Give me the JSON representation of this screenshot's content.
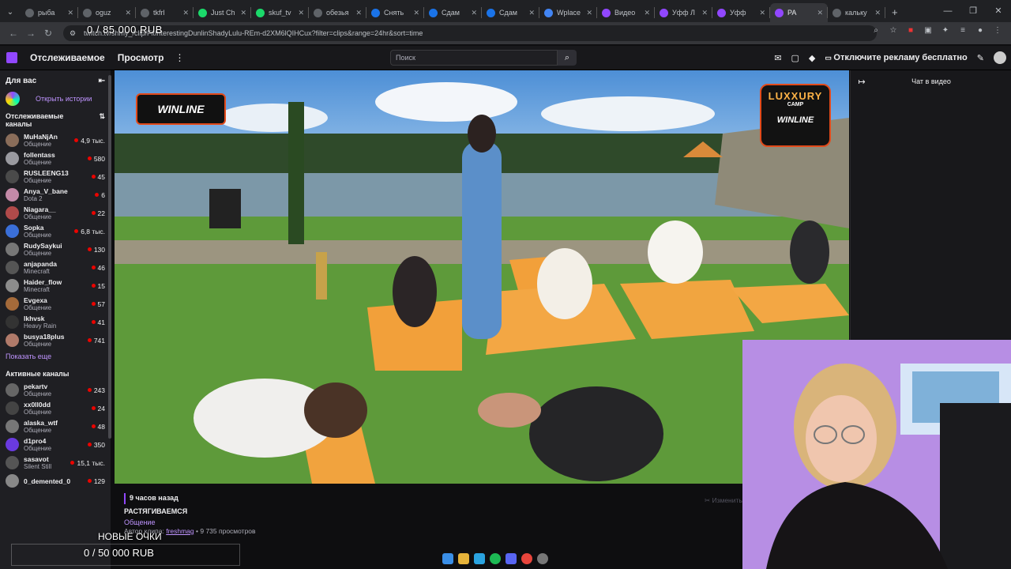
{
  "browser": {
    "tabs": [
      {
        "label": "рыба",
        "color": "#5f6368"
      },
      {
        "label": "oguz",
        "color": "#5f6368"
      },
      {
        "label": "tkfrl",
        "color": "#5f6368"
      },
      {
        "label": "Just Ch",
        "color": "#1bd96a"
      },
      {
        "label": "skuf_tv",
        "color": "#1bd96a"
      },
      {
        "label": "обезья",
        "color": "#5f6368"
      },
      {
        "label": "Снять",
        "color": "#1a73e8"
      },
      {
        "label": "Сдам",
        "color": "#1a73e8"
      },
      {
        "label": "Сдам",
        "color": "#1a73e8"
      },
      {
        "label": "Wplace",
        "color": "#4285f4"
      },
      {
        "label": "Видео",
        "color": "#9147ff"
      },
      {
        "label": "Уфф Л",
        "color": "#9147ff"
      },
      {
        "label": "Уфф",
        "color": "#9147ff"
      },
      {
        "label": "РА",
        "color": "#9147ff"
      },
      {
        "label": "кальку",
        "color": "#5f6368"
      }
    ],
    "active_tab_index": 13,
    "new_tab_icon": "+",
    "url": "twitch.tv/shmy_/clip/FitInterestingDunlinShadyLulu-REm-d2XM6lQIHCux?filter=clips&range=24hr&sort=time"
  },
  "stream_overlay": {
    "top_counter": "0 / 85 000 RUB",
    "new_points": "НОВЫЕ ОЧКИ",
    "bottom_counter": "0 / 50 000 RUB"
  },
  "twitch": {
    "nav": {
      "following": "Отслеживаемое",
      "browse": "Просмотр",
      "search_placeholder": "Поиск",
      "adfree": "Отключите рекламу бесплатно"
    },
    "sidebar": {
      "for_you": "Для вас",
      "open_stories": "Открыть истории",
      "followed_title": "Отслеживаемые каналы",
      "followed": [
        {
          "name": "MuHaNjAn",
          "category": "Общение",
          "viewers": "4,9 тыс.",
          "color": "#8a6d5a"
        },
        {
          "name": "follentass",
          "category": "Общение",
          "viewers": "580",
          "color": "#9a9aa0"
        },
        {
          "name": "RUSLEENG13",
          "category": "Общение",
          "viewers": "45",
          "color": "#4a4a4a"
        },
        {
          "name": "Anya_V_bane",
          "category": "Dota 2",
          "viewers": "6",
          "color": "#c48aa8"
        },
        {
          "name": "Niagara__",
          "category": "Общение",
          "viewers": "22",
          "color": "#b04a4a"
        },
        {
          "name": "Sopka",
          "category": "Общение",
          "viewers": "6,8 тыс.",
          "color": "#3a6fd8"
        },
        {
          "name": "RudySaykui",
          "category": "Общение",
          "viewers": "130",
          "color": "#777"
        },
        {
          "name": "anjapanda",
          "category": "Minecraft",
          "viewers": "46",
          "color": "#555"
        },
        {
          "name": "Haider_flow",
          "category": "Minecraft",
          "viewers": "15",
          "color": "#8c8c8c"
        },
        {
          "name": "Evgexa",
          "category": "Общение",
          "viewers": "57",
          "color": "#a46a3a"
        },
        {
          "name": "lkhvsk",
          "category": "Heavy Rain",
          "viewers": "41",
          "color": "#333"
        },
        {
          "name": "busya18plus",
          "category": "Общение",
          "viewers": "741",
          "color": "#b07a6a"
        }
      ],
      "show_more": "Показать еще",
      "active_title": "Активные каналы",
      "active": [
        {
          "name": "pekartv",
          "category": "Общение",
          "viewers": "243",
          "color": "#666"
        },
        {
          "name": "xx0ll0dd",
          "category": "Общение",
          "viewers": "24",
          "color": "#444"
        },
        {
          "name": "alaska_wtf",
          "category": "Общение",
          "viewers": "48",
          "color": "#777"
        },
        {
          "name": "d1pro4",
          "category": "Общение",
          "viewers": "350",
          "color": "#6a3ae0"
        },
        {
          "name": "sasavot",
          "category": "Silent Still",
          "viewers": "15,1 тыс.",
          "color": "#555"
        },
        {
          "name": "0_demented_0",
          "category": "",
          "viewers": "129",
          "color": "#888"
        }
      ]
    },
    "video": {
      "sponsor_left": "WINLINE",
      "sponsor_right_top": "LUXXURY",
      "sponsor_right_mid": "CAMP",
      "sponsor_right_bottom": "WINLINE"
    },
    "chat": {
      "title": "Чат в видео"
    },
    "clip": {
      "time": "9 часов назад",
      "title": "РАСТЯГИВАЕМСЯ",
      "category": "Общение",
      "author_label": "Автор клипа:",
      "author": "freshmag",
      "views": "• 9 735 просмотров",
      "edit": "Изменить"
    }
  }
}
